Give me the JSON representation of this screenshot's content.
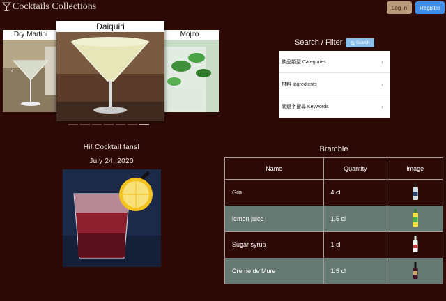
{
  "app": {
    "title": "Cocktails Collections"
  },
  "auth": {
    "login_label": "Log In",
    "register_label": "Register"
  },
  "carousel": {
    "prev_label": "Dry Martini",
    "current_label": "Daiquiri",
    "next_label": "Mojito",
    "prev_arrow": "‹",
    "slides_count": 7,
    "active_index": 6
  },
  "search": {
    "title": "Search / Filter",
    "button_label": "Search",
    "items": [
      {
        "label": "飲品類型 Categories"
      },
      {
        "label": "材料 Ingredients"
      },
      {
        "label": "關鍵字搜尋 Keywords"
      }
    ],
    "chevron": "›"
  },
  "greeting": {
    "line1": "Hi! Cocktail fans!",
    "date": "July 24, 2020"
  },
  "recipe": {
    "title": "Bramble",
    "columns": [
      "Name",
      "Quantity",
      "Image"
    ],
    "rows": [
      {
        "name": "Gin",
        "quantity": "4 cl",
        "image": "gin-bottle-icon"
      },
      {
        "name": "lemon juice",
        "quantity": "1.5 cl",
        "image": "lemon-juice-bottle-icon"
      },
      {
        "name": "Sugar syrup",
        "quantity": "1 cl",
        "image": "syrup-bottle-icon"
      },
      {
        "name": "Creme de Mure",
        "quantity": "1.5 cl",
        "image": "liqueur-bottle-icon"
      }
    ]
  },
  "colors": {
    "background": "#2d0a06",
    "alt_row": "#667973",
    "register": "#3e8ee8",
    "login": "#b99a7a",
    "search_button": "#8cc0ec"
  }
}
